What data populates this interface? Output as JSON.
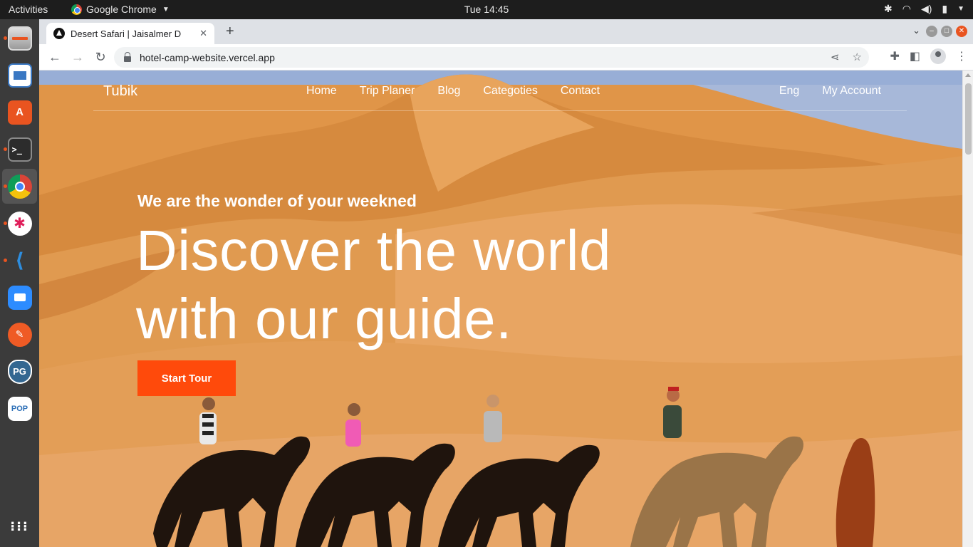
{
  "system_bar": {
    "activities": "Activities",
    "app_name": "Google Chrome",
    "clock": "Tue 14:45"
  },
  "browser": {
    "tab_title": "Desert Safari | Jaisalmer D",
    "url": "hotel-camp-website.vercel.app"
  },
  "site": {
    "brand": "Tubik",
    "nav": [
      "Home",
      "Trip Planer",
      "Blog",
      "Categoties",
      "Contact"
    ],
    "nav_right": [
      "Eng",
      "My Account"
    ],
    "hero_subtitle": "We are the wonder of your weekned",
    "hero_title_line1": "Discover the world",
    "hero_title_line2": "with our guide.",
    "cta": "Start Tour"
  },
  "dock_apps": [
    "files-icon",
    "document-viewer-icon",
    "software-center-icon",
    "terminal-icon",
    "chrome-icon",
    "slack-icon",
    "vscode-icon",
    "zoom-icon",
    "postman-icon",
    "postgres-icon",
    "popos-icon",
    "app-grid-icon"
  ],
  "colors": {
    "cta": "#ff4a0b",
    "dock": "#3b3b3b",
    "topbar": "#1d1d1d"
  }
}
